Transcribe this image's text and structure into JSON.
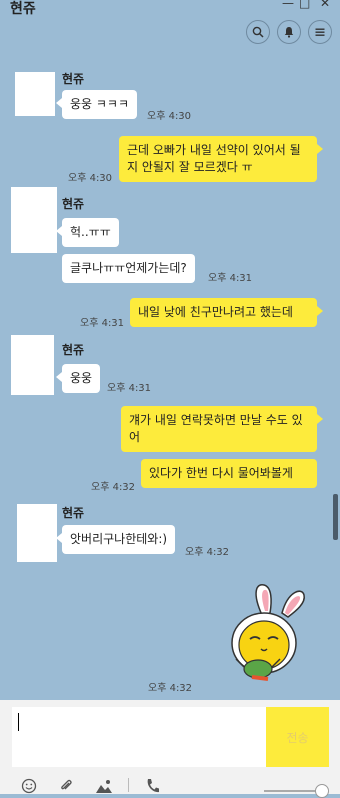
{
  "window": {
    "title": "현쥬"
  },
  "chat": {
    "messages": [
      {
        "sender": "현쥬",
        "text": "웅웅 ㅋㅋㅋ",
        "time": "오후 4:30"
      },
      {
        "text": "근데 오빠가 내일 선약이 있어서 될지 안될지 잘 모르겠다 ㅠ",
        "time": "오후 4:30"
      },
      {
        "sender": "현쥬",
        "text": "헉..ㅠㅠ"
      },
      {
        "text": "글쿠나ㅠㅠ언제가는데?",
        "time": "오후 4:31"
      },
      {
        "text": "내일 낮에 친구만나려고 했는데",
        "time": "오후 4:31"
      },
      {
        "sender": "현쥬",
        "text": "웅웅",
        "time": "오후 4:31"
      },
      {
        "text": "걔가 내일 연락못하면 만날 수도 있어"
      },
      {
        "text": "있다가 한번 다시 물어봐볼게",
        "time": "오후 4:32"
      },
      {
        "sender": "현쥬",
        "text": "앗버리구나한테와:)",
        "time": "오후 4:32"
      },
      {
        "sticker": "rabbit-sticker",
        "time": "오후 4:32"
      }
    ]
  },
  "composer": {
    "send_label": "전송"
  },
  "icons": [
    "search-icon",
    "bell-icon",
    "menu-icon",
    "emoji-icon",
    "attach-icon",
    "image-icon",
    "phone-icon"
  ],
  "colors": {
    "background": "#9bbbd4",
    "my_bubble": "#fdeb3c",
    "their_bubble": "#ffffff"
  }
}
